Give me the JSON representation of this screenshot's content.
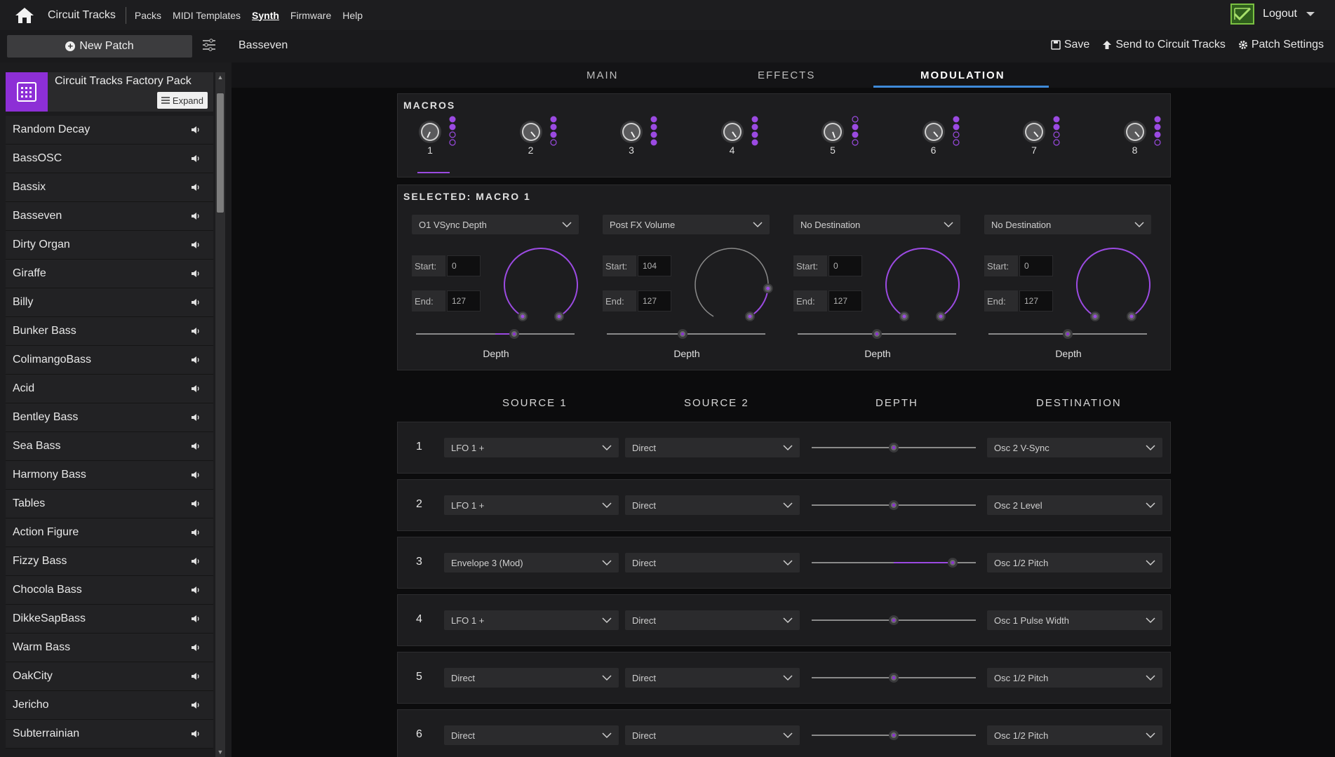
{
  "nav": {
    "brand": "Circuit Tracks",
    "links": [
      "Packs",
      "MIDI Templates",
      "Synth",
      "Firmware",
      "Help"
    ],
    "active": "Synth",
    "logout": "Logout"
  },
  "toolbar": {
    "new_patch": "New Patch",
    "patch_name": "Basseven",
    "save": "Save",
    "send": "Send to Circuit Tracks",
    "settings": "Patch Settings"
  },
  "sidebar": {
    "pack_title": "Circuit Tracks Factory Pack",
    "expand": "Expand",
    "patches": [
      "Random Decay",
      "BassOSC",
      "Bassix",
      "Basseven",
      "Dirty Organ",
      "Giraffe",
      "Billy",
      "Bunker Bass",
      "ColimangoBass",
      "Acid",
      "Bentley Bass",
      "Sea Bass",
      "Harmony Bass",
      "Tables",
      "Action Figure",
      "Fizzy Bass",
      "Chocola Bass",
      "DikkeSapBass",
      "Warm Bass",
      "OakCity",
      "Jericho",
      "Subterrainian"
    ]
  },
  "tabs": [
    "MAIN",
    "EFFECTS",
    "MODULATION"
  ],
  "active_tab": "MODULATION",
  "macros": {
    "title": "MACROS",
    "numbers": [
      "1",
      "2",
      "3",
      "4",
      "5",
      "6",
      "7",
      "8"
    ],
    "selected": "1"
  },
  "selected_macro": {
    "title": "SELECTED: MACRO 1",
    "start_label": "Start:",
    "end_label": "End:",
    "depth_label": "Depth",
    "slots": [
      {
        "destination": "O1 VSync Depth",
        "start": "0",
        "end": "127",
        "depth": 0.62
      },
      {
        "destination": "Post FX Volume",
        "start": "104",
        "end": "127",
        "depth": 0.48
      },
      {
        "destination": "No Destination",
        "start": "0",
        "end": "127",
        "depth": 0.5
      },
      {
        "destination": "No Destination",
        "start": "0",
        "end": "127",
        "depth": 0.5
      }
    ]
  },
  "matrix": {
    "headers": [
      "SOURCE 1",
      "SOURCE 2",
      "DEPTH",
      "DESTINATION"
    ],
    "rows": [
      {
        "index": "1",
        "source1": "LFO 1 +",
        "source2": "Direct",
        "depth": 0.5,
        "destination": "Osc 2 V-Sync"
      },
      {
        "index": "2",
        "source1": "LFO 1 +",
        "source2": "Direct",
        "depth": 0.5,
        "destination": "Osc 2 Level"
      },
      {
        "index": "3",
        "source1": "Envelope 3 (Mod)",
        "source2": "Direct",
        "depth": 0.86,
        "destination": "Osc 1/2 Pitch"
      },
      {
        "index": "4",
        "source1": "LFO 1 +",
        "source2": "Direct",
        "depth": 0.5,
        "destination": "Osc 1 Pulse Width"
      },
      {
        "index": "5",
        "source1": "Direct",
        "source2": "Direct",
        "depth": 0.5,
        "destination": "Osc 1/2 Pitch"
      },
      {
        "index": "6",
        "source1": "Direct",
        "source2": "Direct",
        "depth": 0.5,
        "destination": "Osc 1/2 Pitch"
      }
    ]
  },
  "colors": {
    "accent": "#9b4ae2",
    "pack": "#8d2fd6",
    "tab_underline": "#3f8ad8"
  }
}
